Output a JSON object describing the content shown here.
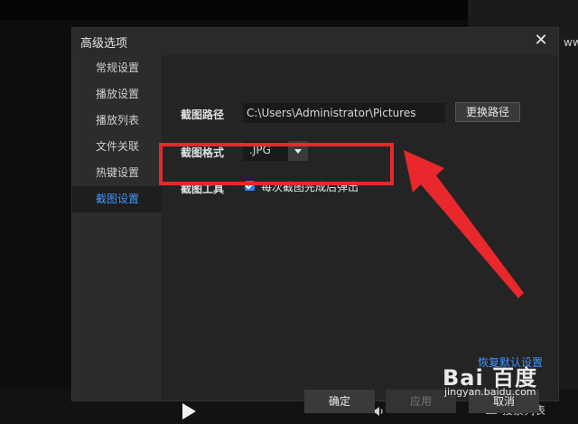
{
  "background": {
    "right_panel_text": "www.c",
    "playlist_button_label": "搜索列表"
  },
  "dialog": {
    "title": "高级选项",
    "sidebar": {
      "items": [
        {
          "label": "常规设置"
        },
        {
          "label": "播放设置"
        },
        {
          "label": "播放列表"
        },
        {
          "label": "文件关联"
        },
        {
          "label": "热键设置"
        },
        {
          "label": "截图设置"
        }
      ],
      "active_index": 5
    },
    "screenshot_settings": {
      "path_label": "截图路径",
      "path_value": "C:\\Users\\Administrator\\Pictures",
      "change_path_button": "更换路径",
      "format_label": "截图格式",
      "format_value": ".JPG",
      "tool_label": "截图工具",
      "popup_checkbox_label": "每次截图完成后弹出",
      "popup_checked": true
    },
    "restore_defaults_link": "恢复默认设置",
    "buttons": {
      "ok": "确定",
      "apply": "应用",
      "cancel": "取消"
    }
  },
  "watermark": {
    "logo_text": "Bai 百度",
    "url": "jingyan.baidu.com"
  },
  "colors": {
    "accent_blue": "#3d95ff",
    "annotation_red": "#e8282c",
    "dialog_bg": "#242424",
    "sidebar_bg": "#2c2c2c"
  }
}
